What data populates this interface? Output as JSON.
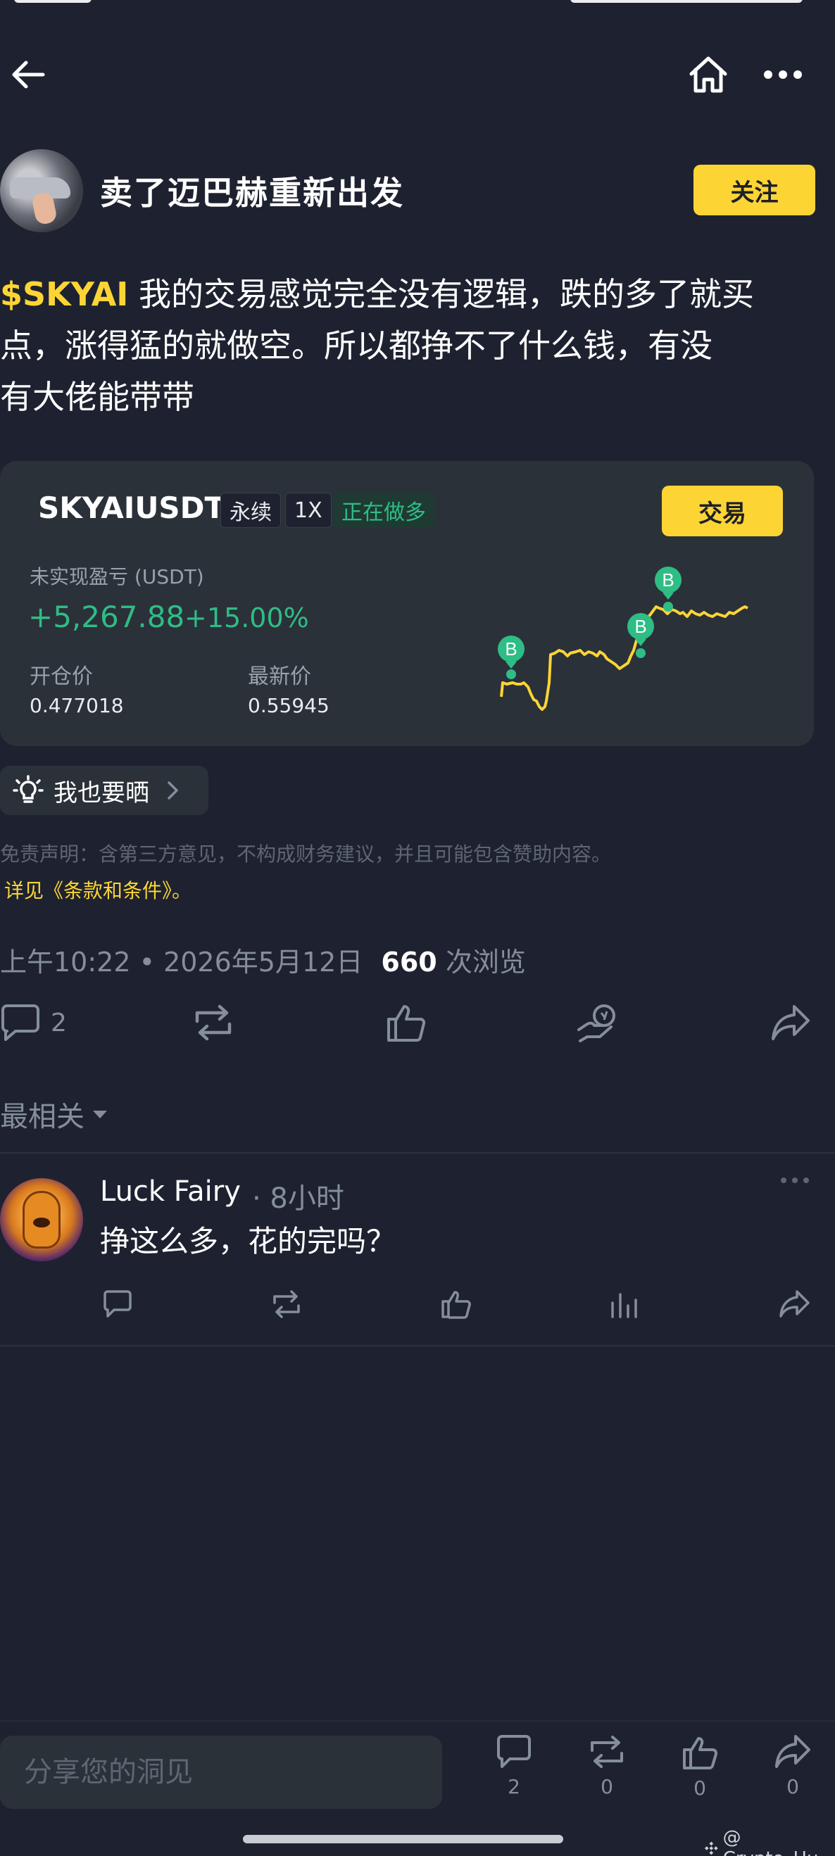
{
  "nav": {
    "back_icon": "arrow-left-icon",
    "home_icon": "home-icon",
    "more_icon": "more-horizontal-icon"
  },
  "author": {
    "name": "卖了迈巴赫重新出发",
    "follow_label": "关注"
  },
  "post": {
    "ticker": "$SKYAI",
    "text_line1": " 我的交易感觉完全没有逻辑，跌的多了就买",
    "text_line2": "点，涨得猛的就做空。所以都挣不了什么钱，有没",
    "text_line3": "有大佬能带带"
  },
  "trade_card": {
    "pair": "SKYAIUSDT",
    "tag_type": "永续",
    "tag_leverage": "1X",
    "tag_position": "正在做多",
    "trade_label": "交易",
    "pnl_label": "未实现盈亏 (USDT)",
    "pnl_value": "+5,267.88",
    "pnl_percent": "+15.00%",
    "entry_label": "开仓价",
    "entry_value": "0.477018",
    "last_label": "最新价",
    "last_value": "0.55945",
    "marker_label": "B",
    "colors": {
      "line": "#fcd535",
      "marker": "#2ebd85"
    }
  },
  "share": {
    "icon": "lightbulb-icon",
    "label": "我也要晒"
  },
  "disclaimer": {
    "text": "免责声明：含第三方意见，不构成财务建议，并且可能包含赞助内容。",
    "terms": "详见《条款和条件》。"
  },
  "meta": {
    "time": "上午10:22 • 2026年5月12日",
    "views_count": "660",
    "views_label": " 次浏览"
  },
  "actions": {
    "comment_count": "2"
  },
  "sort": {
    "label": "最相关"
  },
  "comment": {
    "name": "Luck Fairy",
    "time": "· 8小时",
    "text": "挣这么多，花的完吗？"
  },
  "bottom_bar": {
    "placeholder": "分享您的洞见",
    "comment_count": "2",
    "repost_count": "0",
    "like_count": "0",
    "share_count": "0"
  },
  "watermark": "@ Crypto_Hu",
  "accent_color": "#fcd535",
  "positive_color": "#2ebd85"
}
